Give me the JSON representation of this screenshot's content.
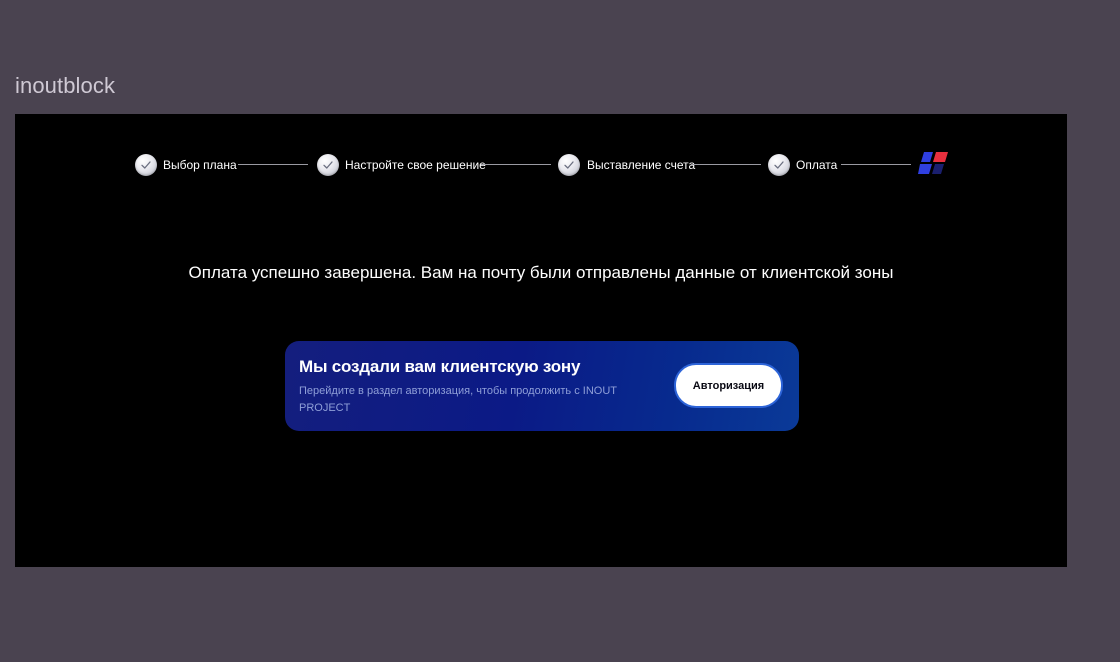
{
  "page_label": "inoutblock",
  "stepper": {
    "steps": [
      {
        "label": "Выбор плана",
        "completed": true
      },
      {
        "label": "Настройте свое решение",
        "completed": true
      },
      {
        "label": "Выставление счета",
        "completed": true
      },
      {
        "label": "Оплата",
        "completed": true
      }
    ],
    "final_icon": "brand-logo-icon"
  },
  "message": "Оплата успешно завершена. Вам на почту были отправлены данные от клиентской зоны",
  "card": {
    "title": "Мы создали вам клиентскую зону",
    "subtitle": "Перейдите в раздел авторизация, чтобы продолжить с INOUT PROJECT",
    "button_label": "Авторизация"
  },
  "colors": {
    "page_background": "#4a4350",
    "frame_background": "#000000",
    "card_gradient_start": "#141e7e",
    "card_gradient_end": "#0a3a98",
    "button_border": "#2d64d8",
    "logo_red": "#e8303e",
    "logo_blue": "#2f3fe0",
    "logo_navy": "#1a1f6e"
  }
}
